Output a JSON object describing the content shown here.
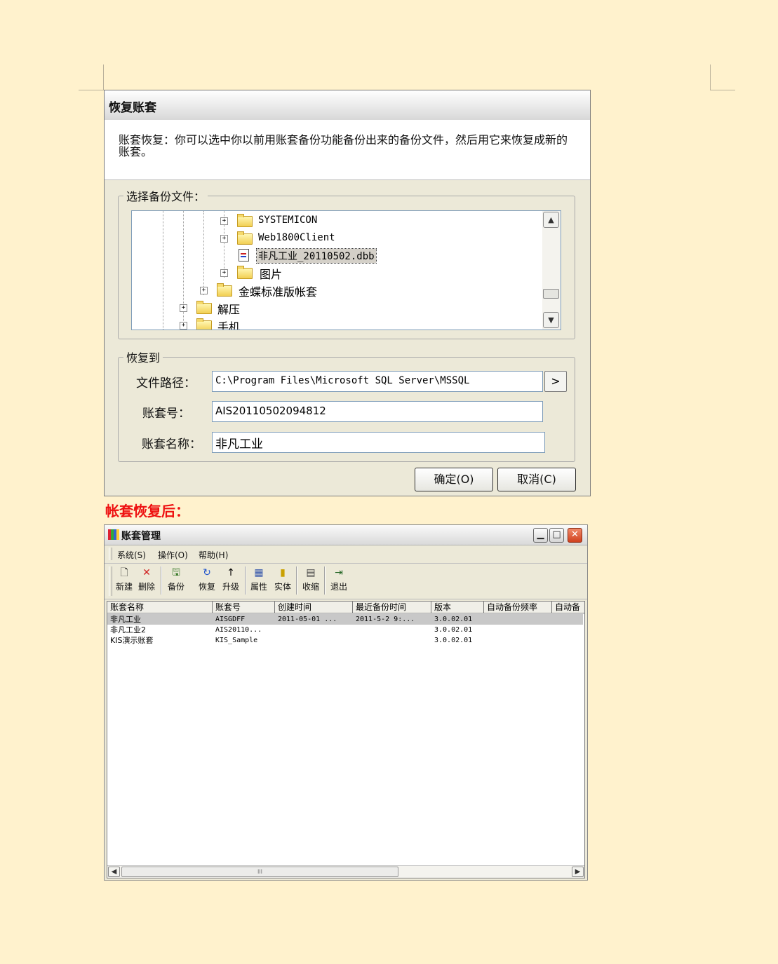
{
  "restore_dialog": {
    "title": "恢复账套",
    "description": "账套恢复：你可以选中你以前用账套备份功能备份出来的备份文件，然后用它来恢复成新的账套。",
    "select_group_label": "选择备份文件：",
    "tree_items": [
      {
        "label": "SYSTEMICON",
        "type": "folder"
      },
      {
        "label": "Web1800Client",
        "type": "folder"
      },
      {
        "label": "非凡工业_20110502.dbb",
        "type": "file",
        "selected": true
      },
      {
        "label": "图片",
        "type": "folder"
      },
      {
        "label": "金蝶标准版帐套",
        "type": "folder"
      },
      {
        "label": "解压",
        "type": "folder"
      },
      {
        "label": "手机",
        "type": "folder"
      }
    ],
    "restore_group_label": "恢复到",
    "file_path_label": "文件路径：",
    "file_path_value": "C:\\Program Files\\Microsoft SQL Server\\MSSQL",
    "account_no_label": "账套号：",
    "account_no_value": "AIS20110502094812",
    "account_name_label": "账套名称：",
    "account_name_value": "非凡工业",
    "browse_label": ">",
    "ok_label": "确定(O)",
    "cancel_label": "取消(C)"
  },
  "caption": "帐套恢复后：",
  "manager_window": {
    "title": "账套管理",
    "menu": [
      "系统(S)",
      "操作(O)",
      "帮助(H)"
    ],
    "toolbar": [
      {
        "label": "新建",
        "icon": "new-icon"
      },
      {
        "label": "删除",
        "icon": "delete-icon"
      },
      {
        "label": "备份",
        "icon": "backup-icon"
      },
      {
        "label": "恢复",
        "icon": "restore-icon"
      },
      {
        "label": "升级",
        "icon": "upgrade-icon"
      },
      {
        "label": "属性",
        "icon": "properties-icon"
      },
      {
        "label": "实体",
        "icon": "entity-icon"
      },
      {
        "label": "收缩",
        "icon": "shrink-icon"
      },
      {
        "label": "退出",
        "icon": "exit-icon"
      }
    ],
    "columns": [
      "账套名称",
      "账套号",
      "创建时间",
      "最近备份时间",
      "版本",
      "自动备份频率",
      "自动备"
    ],
    "rows": [
      {
        "name": "非凡工业",
        "number": "AISGDFF",
        "created": "2011-05-01 ...",
        "last_backup": "2011-5-2 9:...",
        "version": "3.0.02.01",
        "selected": true
      },
      {
        "name": "非凡工业2",
        "number": "AIS20110...",
        "created": "",
        "last_backup": "",
        "version": "3.0.02.01"
      },
      {
        "name": "KIS演示账套",
        "number": "KIS_Sample",
        "created": "",
        "last_backup": "",
        "version": "3.0.02.01"
      }
    ],
    "hscroll_grip": "III"
  },
  "colors": {
    "page_background": "#fff2cd",
    "caption": "#ee1111",
    "selection": "#c8c8c8"
  }
}
